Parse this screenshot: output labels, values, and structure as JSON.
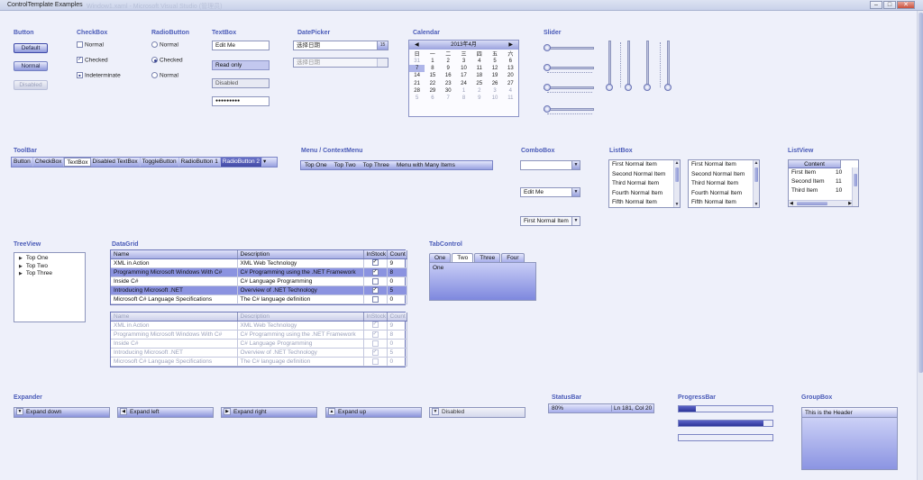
{
  "window": {
    "title": "ControlTemplate Examples",
    "bg_title": "Window1.xaml - Microsoft Visual Studio (管理员)",
    "minimize": "–",
    "maximize": "□",
    "close": "✕"
  },
  "button": {
    "header": "Button",
    "default_label": "Default",
    "normal_label": "Normal",
    "disabled_label": "Disabled"
  },
  "checkbox": {
    "header": "CheckBox",
    "items": [
      {
        "label": "Normal",
        "mark": ""
      },
      {
        "label": "Checked",
        "mark": "✓"
      },
      {
        "label": "Indeterminate",
        "mark": "■"
      }
    ]
  },
  "radio": {
    "header": "RadioButton",
    "items": [
      {
        "label": "Normal"
      },
      {
        "label": "Checked"
      },
      {
        "label": "Normal"
      }
    ]
  },
  "textbox": {
    "header": "TextBox",
    "edit_value": "Edit Me",
    "readonly_value": "Read only",
    "disabled_value": "Disabled",
    "password_value": "●●●●●●●●●"
  },
  "datepicker": {
    "header": "DatePicker",
    "placeholder_1": "选择日期",
    "placeholder_2": "选择日期",
    "cal_icon": "15"
  },
  "calendar": {
    "header": "Calendar",
    "month": "2013年4月",
    "days": [
      "日",
      "一",
      "二",
      "三",
      "四",
      "五",
      "六"
    ],
    "weeks": [
      [
        "31",
        "1",
        "2",
        "3",
        "4",
        "5",
        "6"
      ],
      [
        "7",
        "8",
        "9",
        "10",
        "11",
        "12",
        "13"
      ],
      [
        "14",
        "15",
        "16",
        "17",
        "18",
        "19",
        "20"
      ],
      [
        "21",
        "22",
        "23",
        "24",
        "25",
        "26",
        "27"
      ],
      [
        "28",
        "29",
        "30",
        "1",
        "2",
        "3",
        "4"
      ],
      [
        "5",
        "6",
        "7",
        "8",
        "9",
        "10",
        "11"
      ]
    ],
    "prev": "◀",
    "next": "▶"
  },
  "slider": {
    "header": "Slider"
  },
  "toolbar": {
    "header": "ToolBar",
    "items": [
      "Button",
      "CheckBox",
      "TextBox",
      "Disabled TextBox",
      "ToggleButton",
      "RadioButton 1",
      "RadioButton 2"
    ],
    "overflow": "▾"
  },
  "menu": {
    "header": "Menu / ContextMenu",
    "items": [
      "Top One",
      "Top Two",
      "Top Three",
      "Menu with Many Items"
    ]
  },
  "combobox": {
    "header": "ComboBox",
    "values": [
      "",
      "Edit Me",
      "First Normal Item"
    ],
    "arrow": "▼"
  },
  "listbox": {
    "header": "ListBox",
    "items": [
      "First Normal Item",
      "Second Normal Item",
      "Third Normal Item",
      "Fourth Normal Item",
      "Fifth Normal Item"
    ],
    "up": "▲",
    "down": "▼"
  },
  "listview": {
    "header": "ListView",
    "column": "Content",
    "rows": [
      {
        "name": "First Item",
        "value": "10"
      },
      {
        "name": "Second Item",
        "value": "11"
      },
      {
        "name": "Third Item",
        "value": "10"
      }
    ],
    "left": "◀",
    "right": "▶"
  },
  "treeview": {
    "header": "TreeView",
    "items": [
      "Top One",
      "Top Two",
      "Top Three"
    ],
    "arrow": "▶"
  },
  "datagrid": {
    "header": "DataGrid",
    "columns": [
      "Name",
      "Description",
      "InStock",
      "Count"
    ],
    "rows": [
      {
        "name": "XML in Action",
        "desc": "XML Web Technology",
        "instock": "✓",
        "count": "9"
      },
      {
        "name": "Programming Microsoft Windows With C#",
        "desc": "C# Programming using the .NET Framework",
        "instock": "✓",
        "count": "8"
      },
      {
        "name": "Inside C#",
        "desc": "C# Language Programming",
        "instock": "",
        "count": "0"
      },
      {
        "name": "Introducing Microsoft .NET",
        "desc": "Overview of .NET Technology",
        "instock": "✓",
        "count": "5"
      },
      {
        "name": "Microsoft C# Language Specifications",
        "desc": "The C# language definition",
        "instock": "",
        "count": "0"
      }
    ]
  },
  "tabcontrol": {
    "header": "TabControl",
    "tabs": [
      "One",
      "Two",
      "Three",
      "Four"
    ],
    "content": "One"
  },
  "expander": {
    "header": "Expander",
    "items": [
      {
        "label": "Expand down",
        "arrow": "▼"
      },
      {
        "label": "Expand left",
        "arrow": "◀"
      },
      {
        "label": "Expand right",
        "arrow": "▶"
      },
      {
        "label": "Expand up",
        "arrow": "▲"
      },
      {
        "label": "Disabled",
        "arrow": "▼"
      }
    ]
  },
  "statusbar": {
    "header": "StatusBar",
    "left": "80%",
    "right": "Ln 181, Col 20"
  },
  "progressbar": {
    "header": "ProgressBar",
    "values": [
      0.18,
      0.9,
      0.0
    ]
  },
  "groupbox": {
    "header": "GroupBox",
    "title": "This is the Header"
  }
}
